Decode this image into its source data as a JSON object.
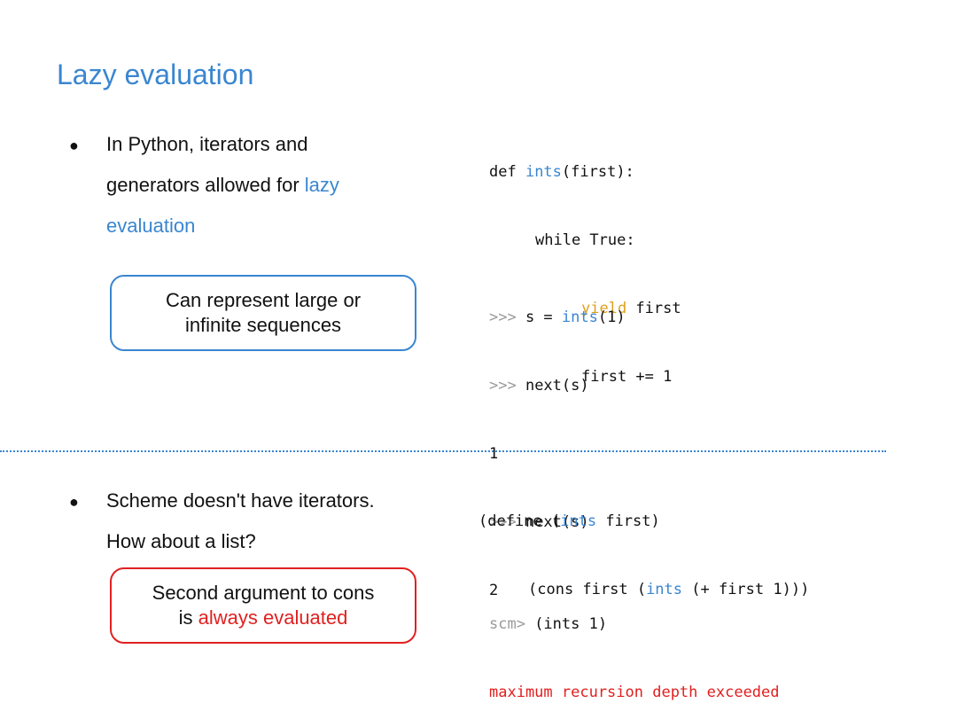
{
  "title": "Lazy evaluation",
  "top": {
    "bullet": {
      "line1": "In Python, iterators and",
      "line2": "generators allowed for ",
      "lazy_word": "lazy",
      "line3": "evaluation"
    },
    "callout": {
      "line1": "Can represent large or",
      "line2": "infinite sequences"
    },
    "code": {
      "def_kw": "def ",
      "fn": "ints",
      "def_rest": "(first):",
      "while_line": "while True:",
      "yield_kw": "yield",
      "yield_rest": " first",
      "incr_line": "first += 1",
      "prompt": ">>> ",
      "assign_pre": "s = ",
      "assign_fn": "ints",
      "assign_post": "(1)",
      "next_call": "next(s)",
      "out1": "1",
      "out2": "2"
    }
  },
  "bottom": {
    "bullet": {
      "line1": "Scheme doesn't have iterators.",
      "line2": "How about a list?"
    },
    "callout": {
      "line1": "Second argument to cons",
      "line2_pre": "is ",
      "line2_red": "always evaluated"
    },
    "code": {
      "def_pre": "(define (",
      "fn": "ints",
      "def_post": " first)",
      "cons_pre": "(cons first (",
      "cons_fn": "ints",
      "cons_post": " (+ first 1)))",
      "prompt": "scm> ",
      "call": "(ints 1)",
      "error": "maximum recursion depth exceeded"
    }
  },
  "colors": {
    "accent_blue": "#3a86d0",
    "error_red": "#e02020",
    "keyword_orange": "#e0a020",
    "prompt_gray": "#9a9a9a"
  }
}
